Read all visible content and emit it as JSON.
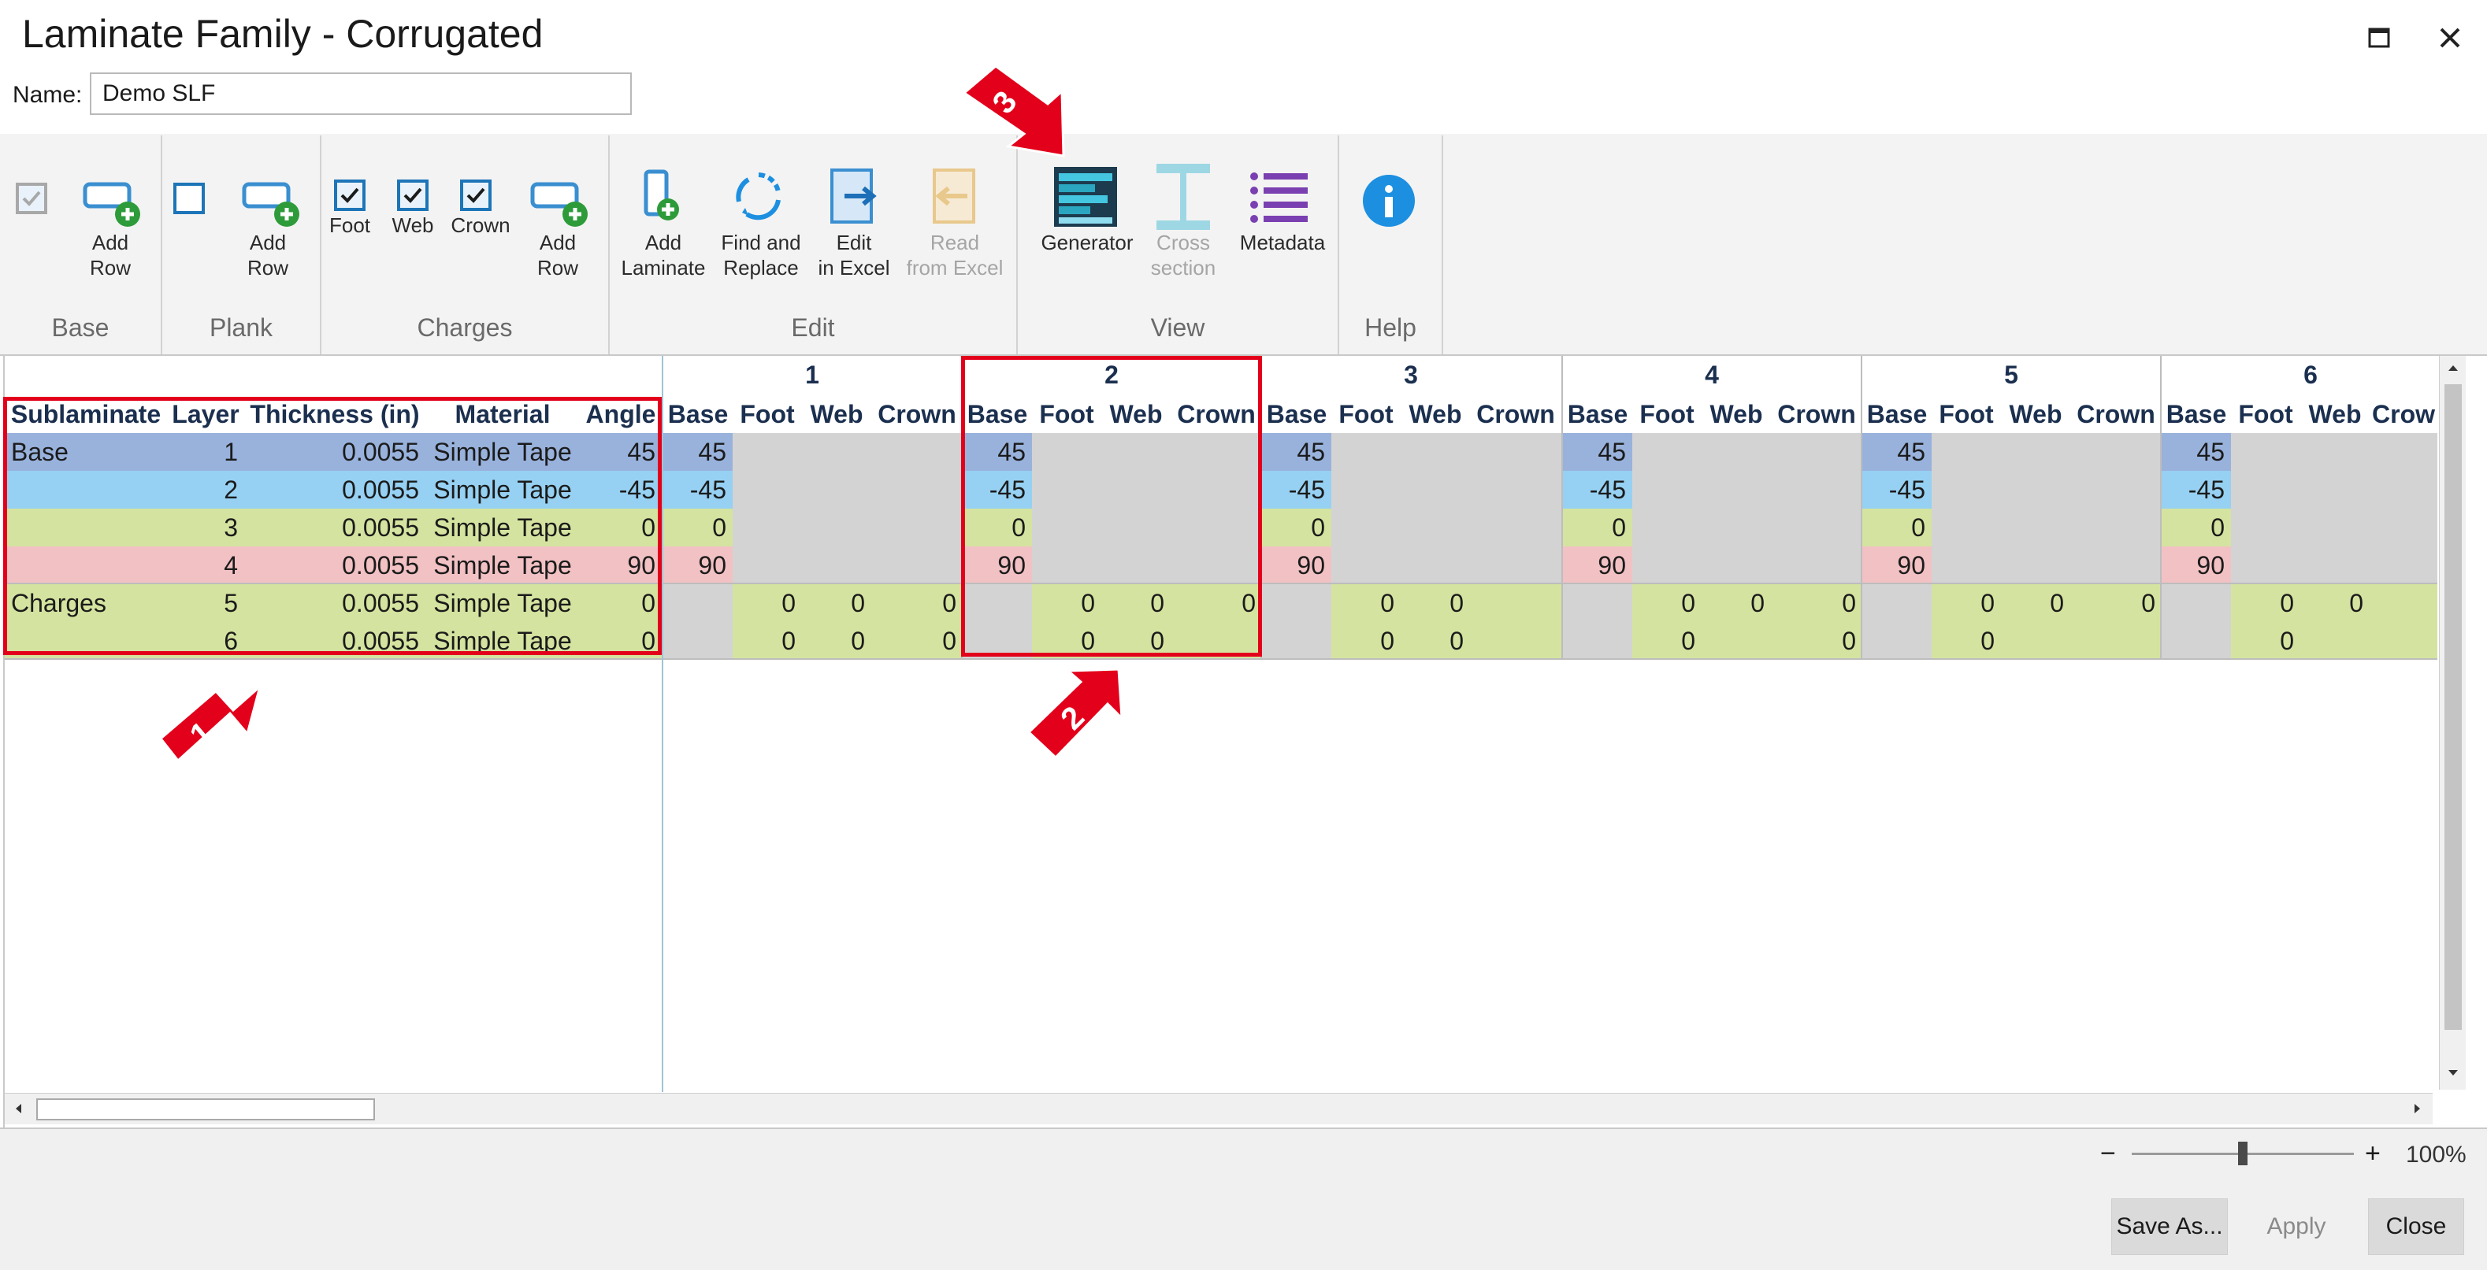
{
  "window": {
    "title": "Laminate Family - Corrugated"
  },
  "name_field": {
    "label": "Name:",
    "value": "Demo SLF"
  },
  "ribbon": {
    "groups": {
      "base": {
        "label": "Base",
        "add_row": "Add\nRow"
      },
      "plank": {
        "label": "Plank",
        "add_row": "Add\nRow"
      },
      "charges": {
        "label": "Charges",
        "foot": "Foot",
        "web": "Web",
        "crown": "Crown",
        "add_row": "Add\nRow"
      },
      "edit": {
        "label": "Edit",
        "add_laminate": "Add\nLaminate",
        "find_replace": "Find and\nReplace",
        "edit_excel": "Edit\nin Excel",
        "read_excel": "Read\nfrom Excel"
      },
      "view": {
        "label": "View",
        "generator": "Generator",
        "cross_section": "Cross\nsection",
        "metadata": "Metadata"
      },
      "help": {
        "label": "Help"
      }
    }
  },
  "grid": {
    "columns": [
      "Sublaminate",
      "Layer",
      "Thickness (in)",
      "Material",
      "Angle"
    ],
    "laminate_columns": [
      "Base",
      "Foot",
      "Web",
      "Crown"
    ],
    "laminates": [
      "1",
      "2",
      "3",
      "4",
      "5",
      "6"
    ],
    "last_crown_truncated": "Crow",
    "rows": [
      {
        "sublaminate": "Base",
        "layer": "1",
        "thickness": "0.0055",
        "material": "Simple Tape",
        "angle": "45"
      },
      {
        "sublaminate": "",
        "layer": "2",
        "thickness": "0.0055",
        "material": "Simple Tape",
        "angle": "-45"
      },
      {
        "sublaminate": "",
        "layer": "3",
        "thickness": "0.0055",
        "material": "Simple Tape",
        "angle": "0"
      },
      {
        "sublaminate": "",
        "layer": "4",
        "thickness": "0.0055",
        "material": "Simple Tape",
        "angle": "90"
      },
      {
        "sublaminate": "Charges",
        "layer": "5",
        "thickness": "0.0055",
        "material": "Simple Tape",
        "angle": "0"
      },
      {
        "sublaminate": "",
        "layer": "6",
        "thickness": "0.0055",
        "material": "Simple Tape",
        "angle": "0"
      }
    ],
    "values": {
      "l1": [
        [
          "45",
          "",
          "",
          ""
        ],
        [
          "-45",
          "",
          "",
          ""
        ],
        [
          "0",
          "",
          "",
          ""
        ],
        [
          "90",
          "",
          "",
          ""
        ],
        [
          "",
          "0",
          "0",
          "0"
        ],
        [
          "",
          "0",
          "0",
          "0"
        ]
      ],
      "l2": [
        [
          "45",
          "",
          "",
          ""
        ],
        [
          "-45",
          "",
          "",
          ""
        ],
        [
          "0",
          "",
          "",
          ""
        ],
        [
          "90",
          "",
          "",
          ""
        ],
        [
          "",
          "0",
          "0",
          "0"
        ],
        [
          "",
          "0",
          "0",
          ""
        ]
      ],
      "l3": [
        [
          "45",
          "",
          "",
          ""
        ],
        [
          "-45",
          "",
          "",
          ""
        ],
        [
          "0",
          "",
          "",
          ""
        ],
        [
          "90",
          "",
          "",
          ""
        ],
        [
          "",
          "0",
          "0",
          ""
        ],
        [
          "",
          "0",
          "0",
          ""
        ]
      ],
      "l4": [
        [
          "45",
          "",
          "",
          ""
        ],
        [
          "-45",
          "",
          "",
          ""
        ],
        [
          "0",
          "",
          "",
          ""
        ],
        [
          "90",
          "",
          "",
          ""
        ],
        [
          "",
          "0",
          "0",
          "0"
        ],
        [
          "",
          "0",
          "",
          "0"
        ]
      ],
      "l5": [
        [
          "45",
          "",
          "",
          ""
        ],
        [
          "-45",
          "",
          "",
          ""
        ],
        [
          "0",
          "",
          "",
          ""
        ],
        [
          "90",
          "",
          "",
          ""
        ],
        [
          "",
          "0",
          "0",
          "0"
        ],
        [
          "",
          "0",
          "",
          ""
        ]
      ],
      "l6": [
        [
          "45",
          "",
          "",
          ""
        ],
        [
          "-45",
          "",
          "",
          ""
        ],
        [
          "0",
          "",
          "",
          ""
        ],
        [
          "90",
          "",
          "",
          ""
        ],
        [
          "",
          "0",
          "0",
          ""
        ],
        [
          "",
          "0",
          "",
          ""
        ]
      ]
    }
  },
  "callouts": [
    "1",
    "2",
    "3"
  ],
  "zoom": {
    "level": "100%",
    "minus": "−",
    "plus": "+",
    "slider_value": 0.5
  },
  "footer": {
    "save_as": "Save As...",
    "apply": "Apply",
    "close": "Close"
  },
  "colors": {
    "accent": "#1d75b8",
    "callout": "#e3001b",
    "base": "#98b2dc",
    "minus45": "#96d0f2",
    "zero": "#d4e39f",
    "ninety": "#f2c1c4"
  }
}
